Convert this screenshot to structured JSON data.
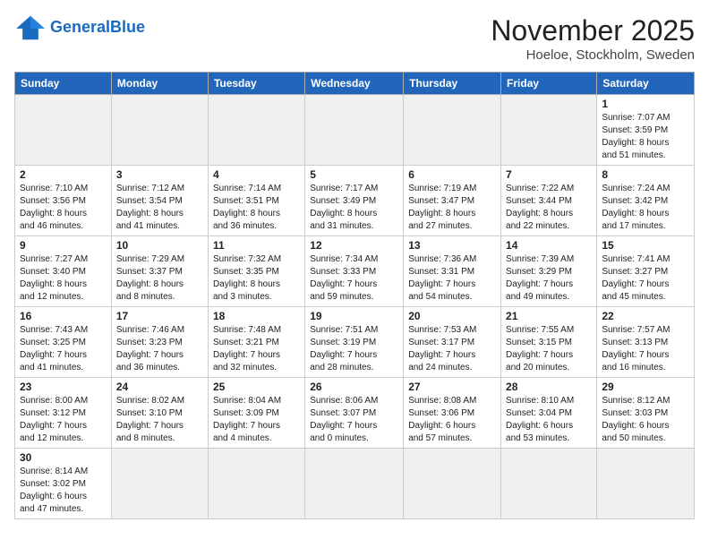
{
  "header": {
    "logo_general": "General",
    "logo_blue": "Blue",
    "month": "November 2025",
    "location": "Hoeloe, Stockholm, Sweden"
  },
  "days_of_week": [
    "Sunday",
    "Monday",
    "Tuesday",
    "Wednesday",
    "Thursday",
    "Friday",
    "Saturday"
  ],
  "weeks": [
    [
      {
        "day": "",
        "info": "",
        "empty": true
      },
      {
        "day": "",
        "info": "",
        "empty": true
      },
      {
        "day": "",
        "info": "",
        "empty": true
      },
      {
        "day": "",
        "info": "",
        "empty": true
      },
      {
        "day": "",
        "info": "",
        "empty": true
      },
      {
        "day": "",
        "info": "",
        "empty": true
      },
      {
        "day": "1",
        "info": "Sunrise: 7:07 AM\nSunset: 3:59 PM\nDaylight: 8 hours\nand 51 minutes."
      }
    ],
    [
      {
        "day": "2",
        "info": "Sunrise: 7:10 AM\nSunset: 3:56 PM\nDaylight: 8 hours\nand 46 minutes."
      },
      {
        "day": "3",
        "info": "Sunrise: 7:12 AM\nSunset: 3:54 PM\nDaylight: 8 hours\nand 41 minutes."
      },
      {
        "day": "4",
        "info": "Sunrise: 7:14 AM\nSunset: 3:51 PM\nDaylight: 8 hours\nand 36 minutes."
      },
      {
        "day": "5",
        "info": "Sunrise: 7:17 AM\nSunset: 3:49 PM\nDaylight: 8 hours\nand 31 minutes."
      },
      {
        "day": "6",
        "info": "Sunrise: 7:19 AM\nSunset: 3:47 PM\nDaylight: 8 hours\nand 27 minutes."
      },
      {
        "day": "7",
        "info": "Sunrise: 7:22 AM\nSunset: 3:44 PM\nDaylight: 8 hours\nand 22 minutes."
      },
      {
        "day": "8",
        "info": "Sunrise: 7:24 AM\nSunset: 3:42 PM\nDaylight: 8 hours\nand 17 minutes."
      }
    ],
    [
      {
        "day": "9",
        "info": "Sunrise: 7:27 AM\nSunset: 3:40 PM\nDaylight: 8 hours\nand 12 minutes."
      },
      {
        "day": "10",
        "info": "Sunrise: 7:29 AM\nSunset: 3:37 PM\nDaylight: 8 hours\nand 8 minutes."
      },
      {
        "day": "11",
        "info": "Sunrise: 7:32 AM\nSunset: 3:35 PM\nDaylight: 8 hours\nand 3 minutes."
      },
      {
        "day": "12",
        "info": "Sunrise: 7:34 AM\nSunset: 3:33 PM\nDaylight: 7 hours\nand 59 minutes."
      },
      {
        "day": "13",
        "info": "Sunrise: 7:36 AM\nSunset: 3:31 PM\nDaylight: 7 hours\nand 54 minutes."
      },
      {
        "day": "14",
        "info": "Sunrise: 7:39 AM\nSunset: 3:29 PM\nDaylight: 7 hours\nand 49 minutes."
      },
      {
        "day": "15",
        "info": "Sunrise: 7:41 AM\nSunset: 3:27 PM\nDaylight: 7 hours\nand 45 minutes."
      }
    ],
    [
      {
        "day": "16",
        "info": "Sunrise: 7:43 AM\nSunset: 3:25 PM\nDaylight: 7 hours\nand 41 minutes."
      },
      {
        "day": "17",
        "info": "Sunrise: 7:46 AM\nSunset: 3:23 PM\nDaylight: 7 hours\nand 36 minutes."
      },
      {
        "day": "18",
        "info": "Sunrise: 7:48 AM\nSunset: 3:21 PM\nDaylight: 7 hours\nand 32 minutes."
      },
      {
        "day": "19",
        "info": "Sunrise: 7:51 AM\nSunset: 3:19 PM\nDaylight: 7 hours\nand 28 minutes."
      },
      {
        "day": "20",
        "info": "Sunrise: 7:53 AM\nSunset: 3:17 PM\nDaylight: 7 hours\nand 24 minutes."
      },
      {
        "day": "21",
        "info": "Sunrise: 7:55 AM\nSunset: 3:15 PM\nDaylight: 7 hours\nand 20 minutes."
      },
      {
        "day": "22",
        "info": "Sunrise: 7:57 AM\nSunset: 3:13 PM\nDaylight: 7 hours\nand 16 minutes."
      }
    ],
    [
      {
        "day": "23",
        "info": "Sunrise: 8:00 AM\nSunset: 3:12 PM\nDaylight: 7 hours\nand 12 minutes."
      },
      {
        "day": "24",
        "info": "Sunrise: 8:02 AM\nSunset: 3:10 PM\nDaylight: 7 hours\nand 8 minutes."
      },
      {
        "day": "25",
        "info": "Sunrise: 8:04 AM\nSunset: 3:09 PM\nDaylight: 7 hours\nand 4 minutes."
      },
      {
        "day": "26",
        "info": "Sunrise: 8:06 AM\nSunset: 3:07 PM\nDaylight: 7 hours\nand 0 minutes."
      },
      {
        "day": "27",
        "info": "Sunrise: 8:08 AM\nSunset: 3:06 PM\nDaylight: 6 hours\nand 57 minutes."
      },
      {
        "day": "28",
        "info": "Sunrise: 8:10 AM\nSunset: 3:04 PM\nDaylight: 6 hours\nand 53 minutes."
      },
      {
        "day": "29",
        "info": "Sunrise: 8:12 AM\nSunset: 3:03 PM\nDaylight: 6 hours\nand 50 minutes."
      }
    ],
    [
      {
        "day": "30",
        "info": "Sunrise: 8:14 AM\nSunset: 3:02 PM\nDaylight: 6 hours\nand 47 minutes."
      },
      {
        "day": "",
        "info": "",
        "empty": true
      },
      {
        "day": "",
        "info": "",
        "empty": true
      },
      {
        "day": "",
        "info": "",
        "empty": true
      },
      {
        "day": "",
        "info": "",
        "empty": true
      },
      {
        "day": "",
        "info": "",
        "empty": true
      },
      {
        "day": "",
        "info": "",
        "empty": true
      }
    ]
  ]
}
